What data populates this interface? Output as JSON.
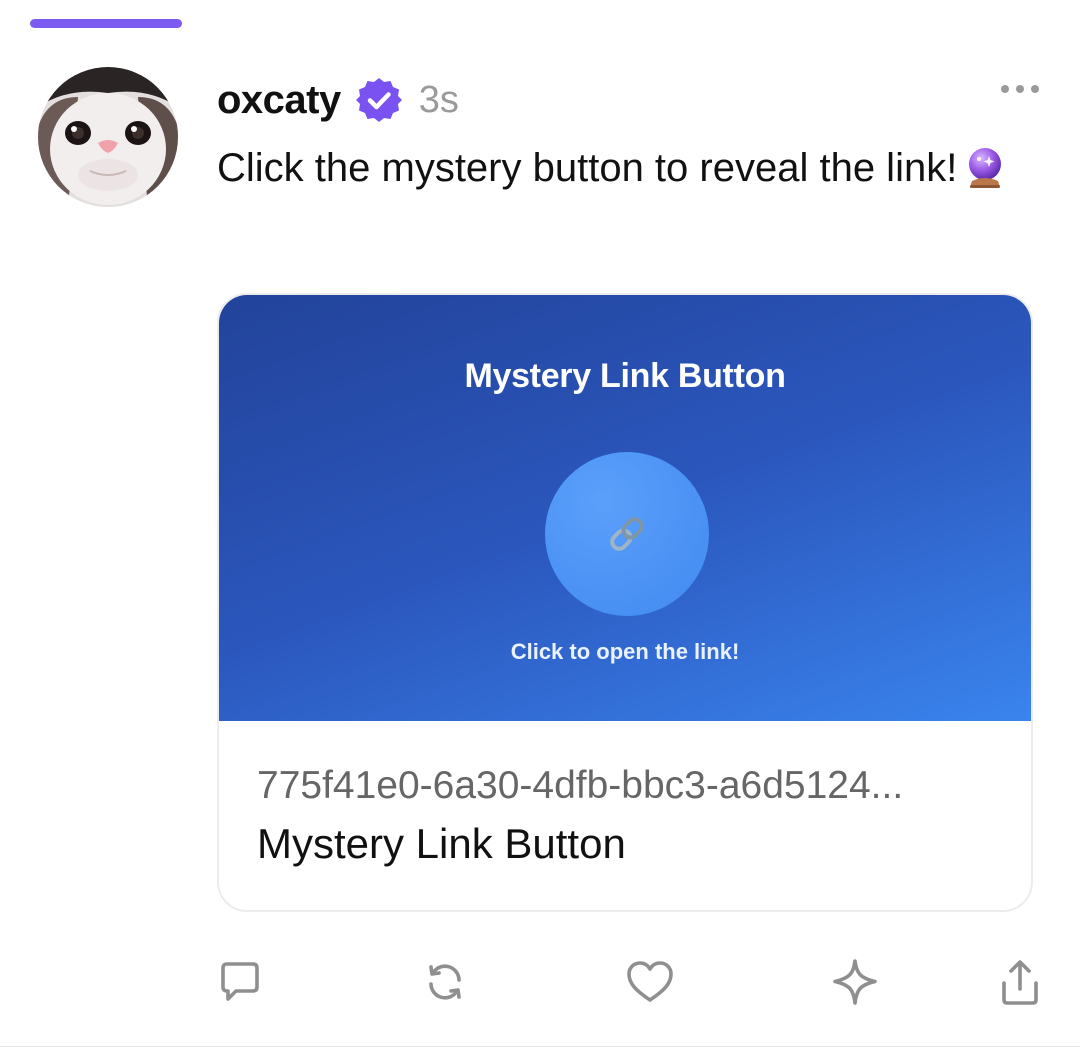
{
  "post": {
    "username": "oxcaty",
    "timestamp": "3s",
    "text": "Click the mystery button to reveal the link!",
    "emoji_icon": "crystal-ball-icon"
  },
  "link_card": {
    "preview": {
      "title": "Mystery Link Button",
      "caption": "Click to open the link!",
      "center_icon": "link-icon"
    },
    "url": "775f41e0-6a30-4dfb-bbc3-a6d5124...",
    "title": "Mystery Link Button"
  },
  "actions": [
    {
      "icon": "comment-icon"
    },
    {
      "icon": "repost-icon"
    },
    {
      "icon": "heart-icon"
    },
    {
      "icon": "sparkle-icon"
    },
    {
      "icon": "share-icon"
    }
  ],
  "colors": {
    "accent": "#7c5cf0",
    "verified_badge": "#7b52f2",
    "preview_gradient_start": "#22439a",
    "preview_gradient_end": "#3a84ee"
  }
}
